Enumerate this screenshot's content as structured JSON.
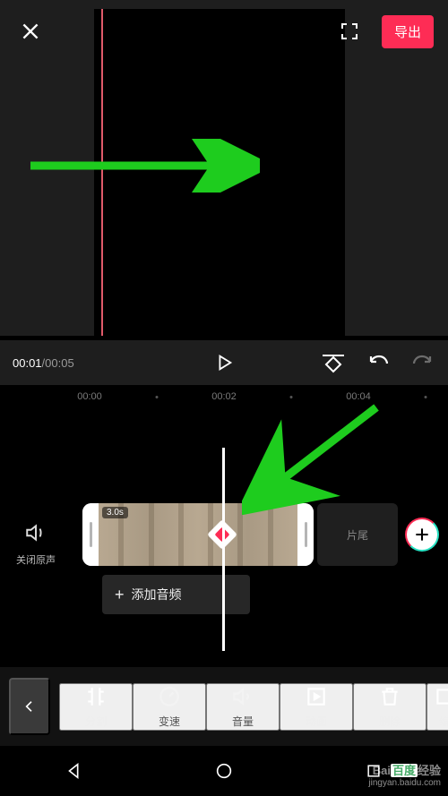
{
  "topbar": {
    "export_label": "导出"
  },
  "player": {
    "current_time": "00:01",
    "total_time": "00:05"
  },
  "ruler": {
    "marks": [
      "00:00",
      "00:02",
      "00:04"
    ]
  },
  "sound_toggle": {
    "label": "关闭原声"
  },
  "clip": {
    "duration_badge": "3.0s"
  },
  "tail_clip": {
    "label": "片尾"
  },
  "audio": {
    "add_label": "添加音频"
  },
  "tools": {
    "split": "分割",
    "speed": "变速",
    "volume": "音量",
    "animation": "动画",
    "delete": "删除",
    "edit": "编"
  },
  "watermark": {
    "brand_a": "Bai",
    "brand_b": "百度",
    "brand_c": "经验",
    "url": "jingyan.baidu.com"
  },
  "colors": {
    "accent": "#fe2c55",
    "annotation": "#1ecc1e"
  }
}
